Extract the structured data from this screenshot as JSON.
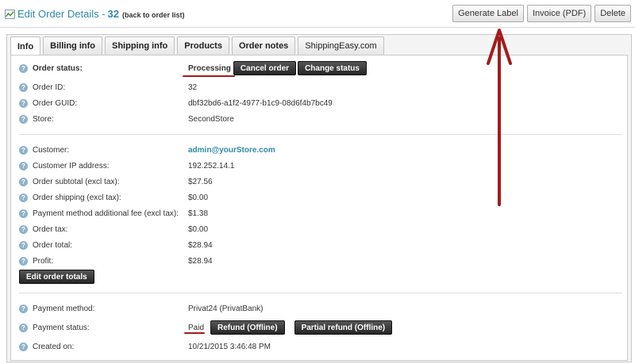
{
  "header": {
    "title": "Edit Order Details -",
    "order_id": "32",
    "back_link": "(back to order list)",
    "buttons": {
      "generate_label": "Generate Label",
      "invoice": "Invoice (PDF)",
      "delete": "Delete"
    }
  },
  "tabs": [
    "Info",
    "Billing info",
    "Shipping info",
    "Products",
    "Order notes",
    "ShippingEasy.com"
  ],
  "order": {
    "status_label": "Order status:",
    "status_value": "Processing",
    "cancel_btn": "Cancel order",
    "change_status_btn": "Change status",
    "id_label": "Order ID:",
    "id_value": "32",
    "guid_label": "Order GUID:",
    "guid_value": "dbf32bd6-a1f2-4977-b1c9-08d6f4b7bc49",
    "store_label": "Store:",
    "store_value": "SecondStore"
  },
  "totals": {
    "customer_label": "Customer:",
    "customer_value": "admin@yourStore.com",
    "ip_label": "Customer IP address:",
    "ip_value": "192.252.14.1",
    "subtotal_label": "Order subtotal (excl tax):",
    "subtotal_value": "$27.56",
    "shipping_label": "Order shipping (excl tax):",
    "shipping_value": "$0.00",
    "fee_label": "Payment method additional fee (excl tax):",
    "fee_value": "$1.38",
    "tax_label": "Order tax:",
    "tax_value": "$0.00",
    "total_label": "Order total:",
    "total_value": "$28.94",
    "profit_label": "Profit:",
    "profit_value": "$28.94",
    "edit_totals_btn": "Edit order totals"
  },
  "payment": {
    "method_label": "Payment method:",
    "method_value": "Privat24 (PrivatBank)",
    "status_label": "Payment status:",
    "status_value": "Paid",
    "refund_btn": "Refund (Offline)",
    "partial_refund_btn": "Partial refund (Offline)",
    "created_label": "Created on:",
    "created_value": "10/21/2015 3:46:48 PM"
  },
  "help_glyph": "?",
  "colors": {
    "link": "#2f89a6",
    "annotation": "#a11d1d"
  }
}
